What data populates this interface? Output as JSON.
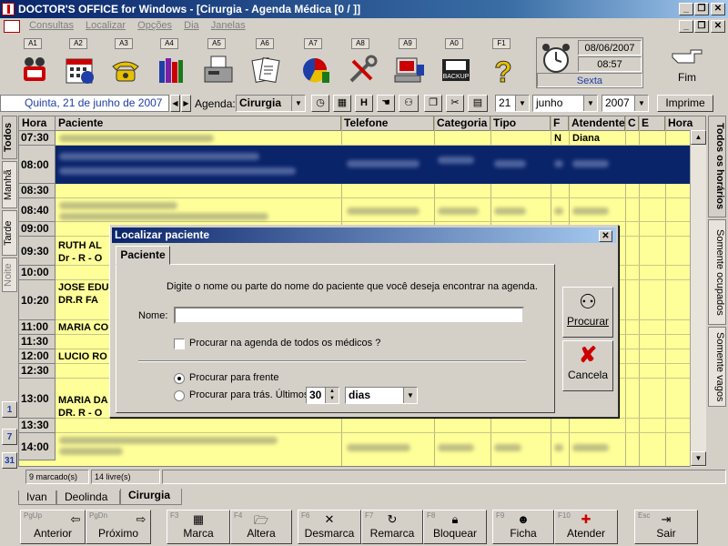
{
  "window": {
    "title": "DOCTOR'S OFFICE for Windows - [Cirurgia - Agenda Médica [0 / ]]"
  },
  "menu": {
    "items": [
      "Consultas",
      "Localizar",
      "Opções",
      "Dia",
      "Janelas"
    ]
  },
  "toolbar": {
    "fkeys": [
      "A1",
      "A2",
      "A3",
      "A4",
      "A5",
      "A6",
      "A7",
      "A8",
      "A9",
      "A0",
      "F1"
    ],
    "icons": [
      "phone-people-icon",
      "calendar-clock-icon",
      "telephone-icon",
      "books-icon",
      "fax-icon",
      "documents-icon",
      "pie-chart-icon",
      "tools-icon",
      "computer-icon",
      "backup-icon",
      "help-icon"
    ],
    "backup_label": "BACKUP",
    "date": "08/06/2007",
    "time": "08:57",
    "weekday": "Sexta",
    "fim_label": "Fim"
  },
  "nav": {
    "date_text": "Quinta, 21 de junho de 2007",
    "agenda_label": "Agenda:",
    "agenda_value": "Cirurgia",
    "h_label": "H",
    "day_value": "21",
    "month_value": "junho",
    "year_value": "2007",
    "print_label": "Imprime"
  },
  "left_tabs": [
    "Todos",
    "Manhã",
    "Tarde",
    "Noite"
  ],
  "left_cal_icons": [
    "1",
    "7",
    "31"
  ],
  "right_tabs": [
    "Todos os horários",
    "Somente ocupados",
    "Somente vagos"
  ],
  "grid": {
    "headers": [
      "Hora",
      "Paciente",
      "Telefone",
      "Categoria",
      "Tipo",
      "F",
      "Atendente",
      "C",
      "E",
      "Hora"
    ],
    "times": [
      "07:30",
      "08:00",
      "08:30",
      "08:40",
      "09:00",
      "09:30",
      "10:00",
      "10:20",
      "11:00",
      "11:30",
      "12:00",
      "12:30",
      "13:00",
      "13:30",
      "14:00"
    ],
    "first_row": {
      "f": "N",
      "attendant": "Diana"
    },
    "patients": [
      {
        "time": "09:30",
        "line1": "RUTH AL",
        "line2": "Dr - R - O"
      },
      {
        "time": "10:20",
        "line1": "JOSE EDU",
        "line2": "DR.R  FA"
      },
      {
        "time": "11:00",
        "line1": "MARIA CO",
        "line2": ""
      },
      {
        "time": "12:00",
        "line1": "LUCIO RO",
        "line2": ""
      },
      {
        "time": "13:00",
        "line1": "MARIA DA",
        "line2": "DR. R - O"
      }
    ]
  },
  "status": {
    "marked": "9 marcado(s)",
    "free": "14 livre(s)"
  },
  "bottom_tabs": [
    "Ivan",
    "Deolinda",
    "Cirurgia"
  ],
  "fbar": [
    {
      "key": "PgUp",
      "label": "Anterior",
      "icon": "arrow-left-icon"
    },
    {
      "key": "PgDn",
      "label": "Próximo",
      "icon": "arrow-right-icon"
    },
    {
      "key": "F3",
      "label": "Marca",
      "icon": "calendar-mark-icon"
    },
    {
      "key": "F4",
      "label": "Altera",
      "icon": "open-folder-icon"
    },
    {
      "key": "F6",
      "label": "Desmarca",
      "icon": "x-icon"
    },
    {
      "key": "F7",
      "label": "Remarca",
      "icon": "refresh-icon"
    },
    {
      "key": "F8",
      "label": "Bloquear",
      "icon": "lock-icon"
    },
    {
      "key": "F9",
      "label": "Ficha",
      "icon": "person-icon"
    },
    {
      "key": "F10",
      "label": "Atender",
      "icon": "red-cross-icon"
    },
    {
      "key": "Esc",
      "label": "Sair",
      "icon": "exit-icon"
    }
  ],
  "dialog": {
    "title": "Localizar paciente",
    "tab": "Paciente",
    "instruction": "Digite o nome ou parte do nome do paciente que você deseja encontrar na agenda.",
    "name_label": "Nome:",
    "name_value": "",
    "check_all_doctors": "Procurar na agenda de todos os médicos ?",
    "radio_forward": "Procurar para frente",
    "radio_back": "Procurar para trás. Últimos",
    "days_value": "30",
    "days_unit": "dias",
    "search_button": "Procurar",
    "cancel_button": "Cancela"
  }
}
